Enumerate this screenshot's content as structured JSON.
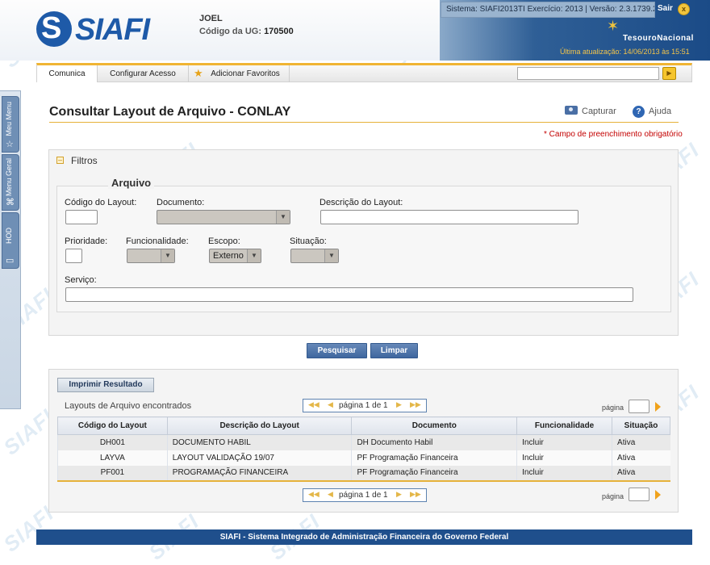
{
  "header": {
    "logo_text": "SIAFI",
    "user_name": "JOEL",
    "ug_label": "Código da UG:",
    "ug_value": "170500",
    "system_info": "Sistema: SIAFI2013TI Exercício: 2013 | Versão: 2.3.1739.239",
    "logout_label": "Sair",
    "brand": "TesouroNacional",
    "last_update": "Última atualização: 14/06/2013 às 15:51"
  },
  "side_tabs": [
    {
      "label": "Meu Menu",
      "icon": "star-icon"
    },
    {
      "label": "Menu Geral",
      "icon": "sitemap-icon"
    },
    {
      "label": "HOD",
      "icon": "monitor-icon"
    }
  ],
  "menu": {
    "items": [
      "Comunica",
      "Configurar Acesso",
      "Adicionar Favoritos"
    ],
    "search_value": ""
  },
  "page": {
    "title": "Consultar Layout de Arquivo - CONLAY",
    "capture_label": "Capturar",
    "help_label": "Ajuda",
    "required_note": "* Campo de preenchimento obrigatório"
  },
  "filters": {
    "panel_label": "Filtros",
    "group_label": "Arquivo",
    "codigo_label": "Código do Layout:",
    "codigo_value": "",
    "documento_label": "Documento:",
    "documento_value": "",
    "descricao_label": "Descrição do Layout:",
    "descricao_value": "",
    "prioridade_label": "Prioridade:",
    "prioridade_value": "",
    "funcionalidade_label": "Funcionalidade:",
    "funcionalidade_value": "",
    "escopo_label": "Escopo:",
    "escopo_value": "Externo",
    "situacao_label": "Situação:",
    "situacao_value": "",
    "servico_label": "Serviço:",
    "servico_value": ""
  },
  "actions": {
    "search_label": "Pesquisar",
    "clear_label": "Limpar"
  },
  "results": {
    "print_label": "Imprimir Resultado",
    "caption": "Layouts de Arquivo encontrados",
    "pager_text": "página 1 de 1",
    "page_label": "página",
    "columns": [
      "Código do Layout",
      "Descrição do Layout",
      "Documento",
      "Funcionalidade",
      "Situação"
    ],
    "rows": [
      [
        "DH001",
        "DOCUMENTO HABIL",
        "DH Documento Habil",
        "Incluir",
        "Ativa"
      ],
      [
        "LAYVA",
        "LAYOUT VALIDAÇÃO 19/07",
        "PF Programação Financeira",
        "Incluir",
        "Ativa"
      ],
      [
        "PF001",
        "PROGRAMAÇÃO FINANCEIRA",
        "PF Programação Financeira",
        "Incluir",
        "Ativa"
      ]
    ]
  },
  "footer": {
    "text": "SIAFI - Sistema Integrado de Administração Financeira do Governo Federal"
  },
  "watermark_text": "SIAFI"
}
